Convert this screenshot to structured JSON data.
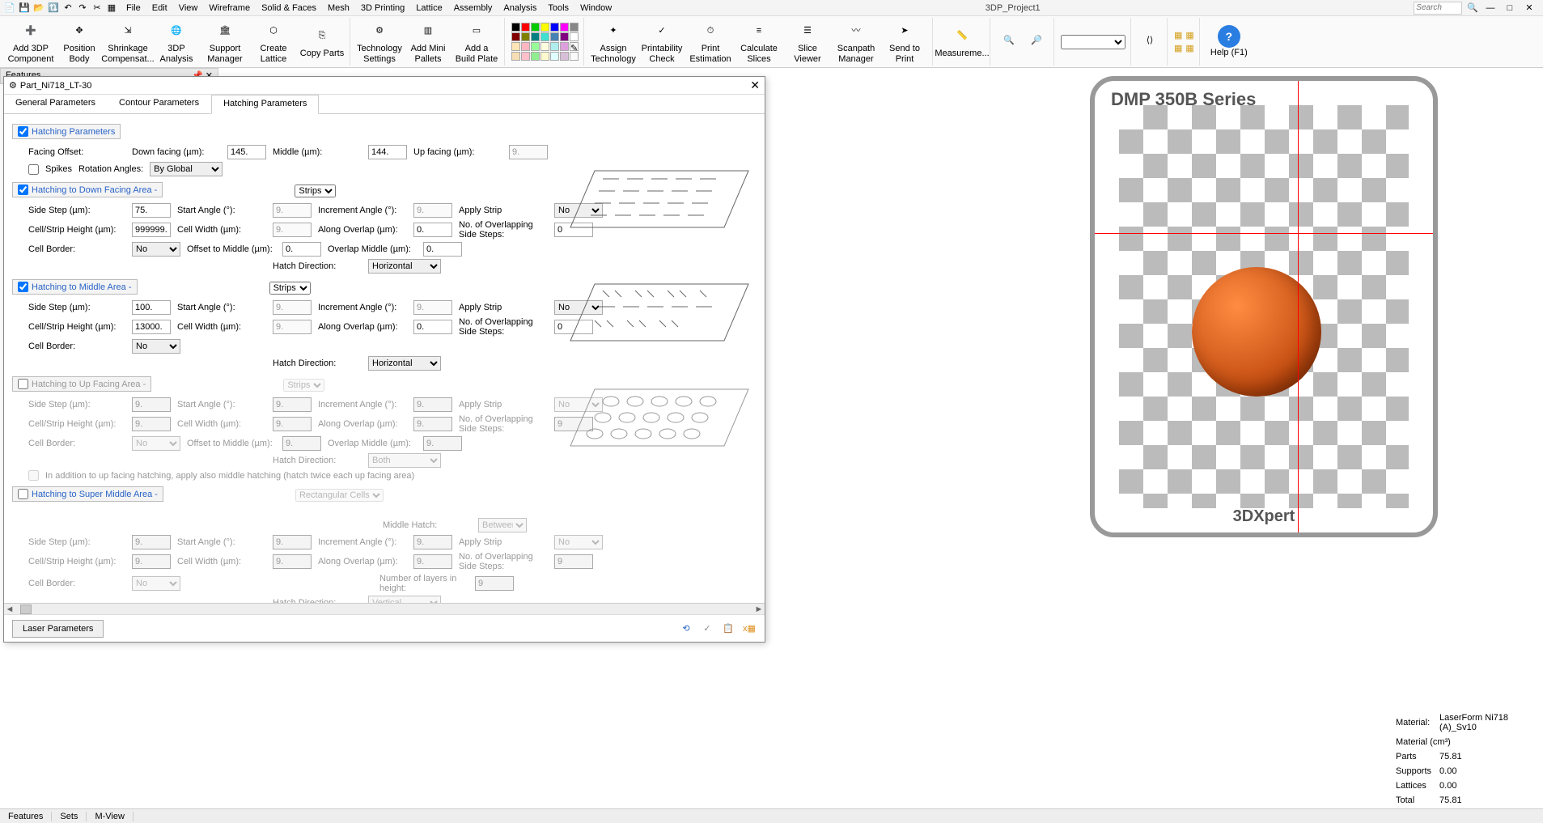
{
  "app": {
    "title": "3DP_Project1",
    "search_placeholder": "Search"
  },
  "menus": [
    "File",
    "Edit",
    "View",
    "Wireframe",
    "Solid & Faces",
    "Mesh",
    "3D Printing",
    "Lattice",
    "Assembly",
    "Analysis",
    "Tools",
    "Window"
  ],
  "ribbon": {
    "g1": [
      {
        "label": "Add 3DP Component"
      },
      {
        "label": "Position Body"
      },
      {
        "label": "Shrinkage Compensat..."
      },
      {
        "label": "3DP Analysis"
      },
      {
        "label": "Support Manager"
      },
      {
        "label": "Create Lattice"
      },
      {
        "label": "Copy Parts"
      }
    ],
    "g2": [
      {
        "label": "Technology Settings"
      },
      {
        "label": "Add Mini Pallets"
      },
      {
        "label": "Add a Build Plate"
      }
    ],
    "g3": [
      {
        "label": "Assign Technology"
      },
      {
        "label": "Printability Check"
      },
      {
        "label": "Print Estimation"
      },
      {
        "label": "Calculate Slices"
      },
      {
        "label": "Slice Viewer"
      },
      {
        "label": "Scanpath Manager"
      },
      {
        "label": "Send to Print"
      }
    ],
    "g4": [
      {
        "label": "Measureme..."
      }
    ],
    "help": "Help (F1)"
  },
  "viewport": {
    "bp_title": "DMP 350B Series",
    "bp_logo": "3DXpert"
  },
  "material": {
    "mat_label": "Material:",
    "mat_value": "LaserForm Ni718 (A)_Sv10",
    "matcm_label": "Material (cm³)",
    "parts_label": "Parts",
    "parts_value": "75.81",
    "supports_label": "Supports",
    "supports_value": "0.00",
    "lattices_label": "Lattices",
    "lattices_value": "0.00",
    "total_label": "Total",
    "total_value": "75.81"
  },
  "bottom_tabs": [
    "Features",
    "Sets",
    "M-View"
  ],
  "featpanel": "Features",
  "dialog": {
    "title": "Part_Ni718_LT-30",
    "tabs": [
      "General Parameters",
      "Contour Parameters",
      "Hatching Parameters"
    ],
    "active_tab": 2,
    "laser_btn": "Laser Parameters",
    "sections": {
      "hp": {
        "label": "Hatching Parameters",
        "checked": true
      },
      "facing": {
        "facing_offset": "Facing Offset:",
        "down_label": "Down facing (µm):",
        "down": "145.",
        "mid_label": "Middle (µm):",
        "mid": "144.",
        "up_label": "Up facing (µm):",
        "up": "9.",
        "spikes": "Spikes",
        "rot_label": "Rotation Angles:",
        "rot": "By Global"
      },
      "down": {
        "label": "Hatching to Down Facing Area -",
        "checked": true,
        "type": "Strips",
        "side_step_l": "Side Step (µm):",
        "side_step": "75.",
        "start_angle_l": "Start Angle (°):",
        "start_angle": "9.",
        "inc_angle_l": "Increment Angle (°):",
        "inc_angle": "9.",
        "apply_strip_l": "Apply Strip",
        "apply_strip": "No",
        "csh_l": "Cell/Strip Height (µm):",
        "csh": "999999.",
        "cw_l": "Cell Width (µm):",
        "cw": "9.",
        "ao_l": "Along Overlap (µm):",
        "ao": "0.",
        "noss_l": "No. of Overlapping Side Steps:",
        "noss": "0",
        "cb_l": "Cell Border:",
        "cb": "No",
        "otm_l": "Offset to Middle (µm):",
        "otm": "0.",
        "om_l": "Overlap Middle (µm):",
        "om": "0.",
        "hd_l": "Hatch Direction:",
        "hd": "Horizontal"
      },
      "middle": {
        "label": "Hatching to Middle Area -",
        "checked": true,
        "type": "Strips",
        "side_step": "100.",
        "start_angle": "9.",
        "inc_angle": "9.",
        "apply_strip": "No",
        "csh": "13000.",
        "cw": "9.",
        "ao": "0.",
        "noss": "0",
        "cb": "No",
        "hd": "Horizontal"
      },
      "up": {
        "label": "Hatching to Up Facing Area -",
        "checked": false,
        "type": "Strips",
        "side_step": "9.",
        "start_angle": "9.",
        "inc_angle": "9.",
        "apply_strip": "No",
        "csh": "9.",
        "cw": "9.",
        "ao": "9.",
        "noss": "9",
        "cb": "No",
        "otm": "9.",
        "om": "9.",
        "hd": "Both",
        "addition": "In addition to up facing hatching, apply also middle hatching (hatch twice each up facing area)"
      },
      "super": {
        "label": "Hatching to Super Middle Area -",
        "checked": false,
        "type": "Rectangular Cells",
        "mh_l": "Middle Hatch:",
        "mh": "Between",
        "side_step": "9.",
        "start_angle": "9.",
        "inc_angle": "9.",
        "apply_strip": "No",
        "csh": "9.",
        "cw": "9.",
        "ao": "9.",
        "noss": "9",
        "cb": "No",
        "nlh_l": "Number of layers in height:",
        "nlh": "9",
        "hd": "Vertical"
      }
    }
  }
}
